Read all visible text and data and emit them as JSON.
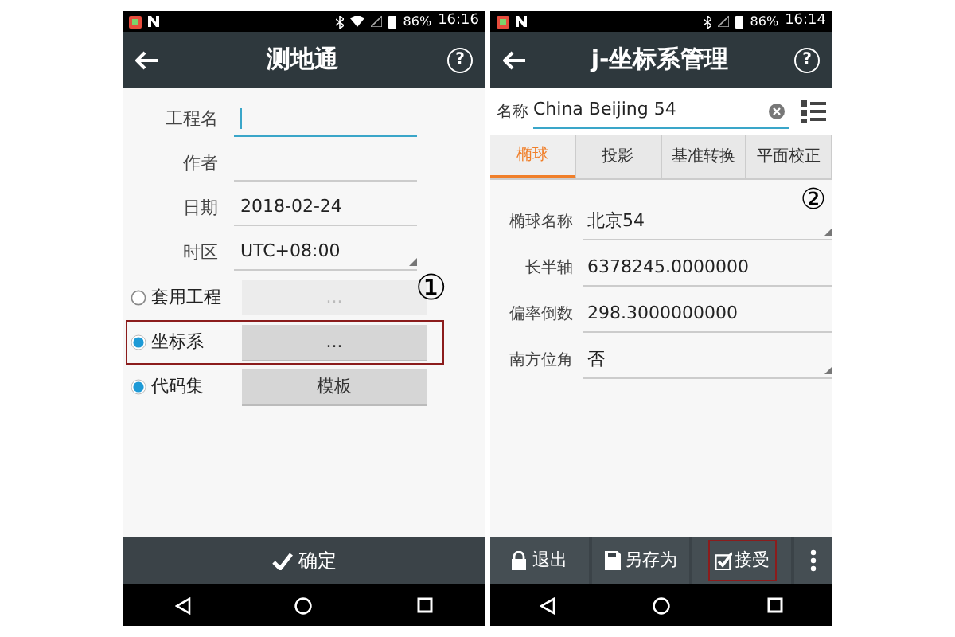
{
  "left_screen": {
    "status_bar": {
      "battery": "86%",
      "time": "16:16",
      "wifi": true
    },
    "title": "测地通",
    "help": "?",
    "fields": [
      {
        "label": "工程名",
        "focused": true,
        "kind": "input"
      },
      {
        "label": "作者",
        "focused": false,
        "kind": "input"
      },
      {
        "label": "日期",
        "value": "2018-02-24",
        "focused": false,
        "kind": "input"
      },
      {
        "label": "时区",
        "value": "UTC+08:00",
        "focused": false,
        "kind": "dropdown"
      }
    ],
    "options": [
      {
        "label": "套用工程",
        "selected": false,
        "button": "...",
        "disabled": true,
        "highlighted": false
      },
      {
        "label": "坐标系",
        "selected": true,
        "button": "...",
        "disabled": false,
        "highlighted": true
      },
      {
        "label": "代码集",
        "selected": true,
        "button": "模板",
        "disabled": false,
        "highlighted": false
      }
    ],
    "annotation": "①",
    "confirm_button": "确定"
  },
  "right_screen": {
    "status_bar": {
      "battery": "86%",
      "time": "16:14",
      "wifi": false
    },
    "title": "j-坐标系管理",
    "help": "?",
    "name_label": "名称",
    "name_value": "China Beijing 54",
    "tabs": [
      {
        "label": "椭球",
        "selected": true
      },
      {
        "label": "投影",
        "selected": false
      },
      {
        "label": "基准转换",
        "selected": false
      },
      {
        "label": "平面校正",
        "selected": false
      }
    ],
    "annotation": "②",
    "fields": [
      {
        "label": "椭球名称",
        "value": "北京54",
        "kind": "dropdown"
      },
      {
        "label": "长半轴",
        "value": "6378245.0000000",
        "kind": "input"
      },
      {
        "label": "偏率倒数",
        "value": "298.3000000000",
        "kind": "input"
      },
      {
        "label": "南方位角",
        "value": "否",
        "kind": "dropdown"
      }
    ],
    "toolbar": [
      {
        "label": "退出",
        "kind": "exit",
        "highlighted": false
      },
      {
        "label": "另存为",
        "kind": "save_as",
        "highlighted": false
      },
      {
        "label": "接受",
        "kind": "accept",
        "highlighted": true
      }
    ]
  }
}
